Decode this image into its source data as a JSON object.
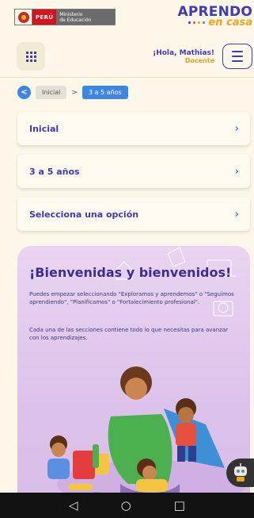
{
  "header": {
    "ministry": {
      "peru": "PERÚ",
      "line1": "Ministerio",
      "line2": "de Educación"
    },
    "brand": {
      "aprendo": "APRENDO",
      "en_casa": "en casa"
    },
    "greeting": "¡Hola, Mathias!",
    "role": "Docente",
    "icons": {
      "apps": "grid-icon",
      "menu": "hamburger-icon"
    }
  },
  "breadcrumb": {
    "back_icon": "chevron-left-icon",
    "items": [
      "Inicial",
      "3 a 5 años"
    ],
    "separator": ">"
  },
  "cards": [
    {
      "label": "Inicial"
    },
    {
      "label": "3 a 5 años"
    },
    {
      "label": "Selecciona una opción"
    }
  ],
  "hero": {
    "title": "¡Bienvenidas y bienvenidos!",
    "paragraph1": "Puedes empezar seleccionando \"Exploramos y aprendemos\" o \"Seguimos aprendiendo\", \"Planificamos\" o \"Fortalecimiento profesional\".",
    "paragraph2": "Cada una de las secciones contiene todo lo que necesitas para avanzar con los aprendizajes."
  },
  "android_nav": {
    "back": "◁",
    "home": "○",
    "recents": "□"
  },
  "colors": {
    "primary": "#3f3bb0",
    "accent_blue": "#3f86e0",
    "accent_orange": "#f1a51f",
    "background": "#fdf7e9",
    "hero_bg": "#dcc2ea"
  }
}
